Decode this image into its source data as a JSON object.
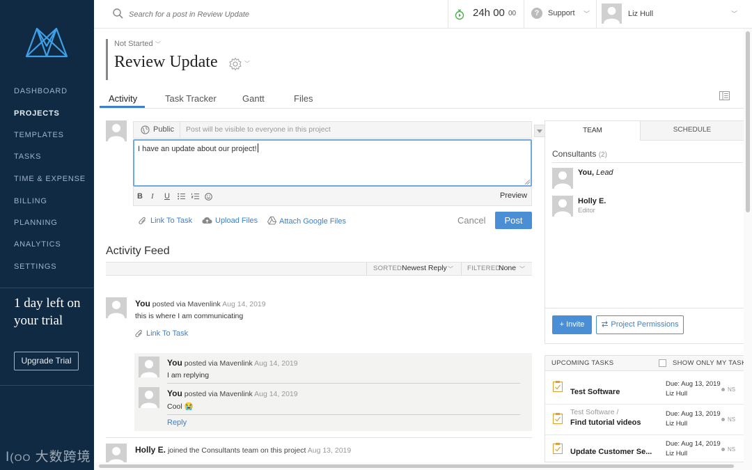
{
  "sidebar": {
    "nav": [
      "DASHBOARD",
      "PROJECTS",
      "TEMPLATES",
      "TASKS",
      "TIME & EXPENSE",
      "BILLING",
      "PLANNING",
      "ANALYTICS",
      "SETTINGS"
    ],
    "active": "PROJECTS",
    "trial_text": "1 day left on your trial",
    "upgrade_label": "Upgrade Trial"
  },
  "watermark": "大数跨境",
  "topbar": {
    "search_placeholder": "Search for a post in Review Update",
    "timer": "24h 00",
    "timer_seconds": "00",
    "support_label": "Support",
    "user_name": "Liz Hull"
  },
  "project": {
    "status": "Not Started",
    "title": "Review Update"
  },
  "tabs": [
    "Activity",
    "Task Tracker",
    "Gantt",
    "Files"
  ],
  "active_tab": "Activity",
  "composer": {
    "visibility_label": "Public",
    "visibility_text": "Post will be visible to everyone in this project",
    "text": "I have an update about our project!",
    "format_buttons": [
      "B",
      "I",
      "U",
      "bulleted-list",
      "numbered-list",
      "emoji"
    ],
    "preview_label": "Preview",
    "link_to_task": "Link To Task",
    "upload_files": "Upload Files",
    "attach_google": "Attach Google Files",
    "cancel_label": "Cancel",
    "post_label": "Post"
  },
  "feed": {
    "title": "Activity Feed",
    "sorted_label": "SORTED:",
    "sorted_value": "Newest Reply",
    "filtered_label": "FILTERED:",
    "filtered_value": "None",
    "post": {
      "author": "You",
      "via": "posted via Mavenlink",
      "date": "Aug 14, 2019",
      "body": "this is where I am communicating",
      "link_to_task": "Link To Task"
    },
    "replies": [
      {
        "author": "You",
        "via": "posted via Mavenlink",
        "date": "Aug 14, 2019",
        "body": "I am replying"
      },
      {
        "author": "You",
        "via": "posted via Mavenlink",
        "date": "Aug 14, 2019",
        "body": "Cool 😭"
      }
    ],
    "reply_label": "Reply",
    "joined": {
      "author": "Holly E.",
      "text": "joined the Consultants team on this project",
      "date": "Aug 13, 2019"
    }
  },
  "team_panel": {
    "tabs": [
      "TEAM",
      "SCHEDULE"
    ],
    "group_label": "Consultants",
    "group_count": "(2)",
    "members": [
      {
        "name": "You,",
        "role_inline": "Lead",
        "role": ""
      },
      {
        "name": "Holly E.",
        "role_inline": "",
        "role": "Editor"
      }
    ],
    "invite_label": "+ Invite",
    "permissions_label": "Project Permissions"
  },
  "upcoming_tasks": {
    "title": "UPCOMING TASKS",
    "only_mine_label": "SHOW ONLY MY TASKS",
    "tasks": [
      {
        "parent": "",
        "name": "Test Software",
        "due": "Due: Aug 13, 2019",
        "assignee": "Liz Hull",
        "status": "NS"
      },
      {
        "parent": "Test Software /",
        "name": "Find tutorial videos",
        "due": "Due: Aug 13, 2019",
        "assignee": "Liz Hull",
        "status": "NS"
      },
      {
        "parent": "",
        "name": "Update Customer Se...",
        "due": "Due: Aug 14, 2019",
        "assignee": "Liz Hull",
        "status": "NS"
      }
    ]
  },
  "colors": {
    "sidebar_bg": "#102a43",
    "accent": "#4a8ed6",
    "focus_border": "#6ea8de"
  }
}
